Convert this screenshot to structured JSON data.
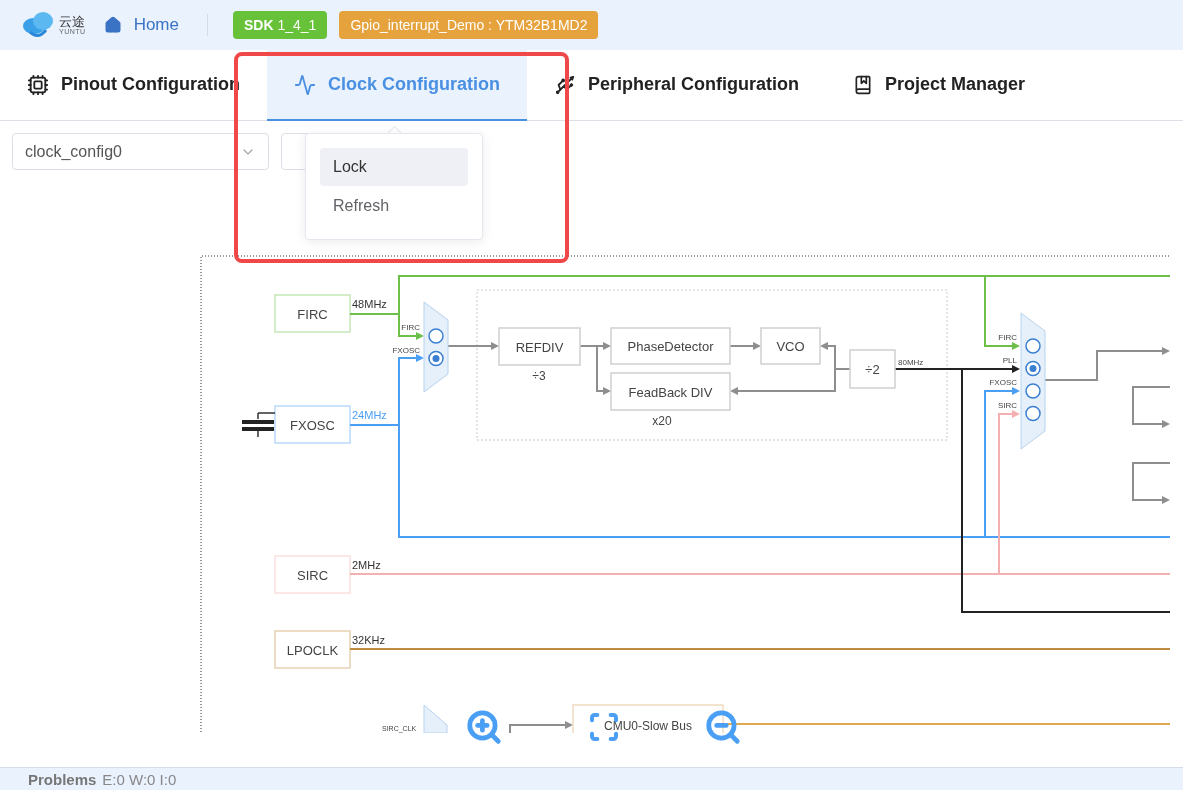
{
  "header": {
    "logo_text": "云途",
    "logo_subtext": "YUNTU",
    "home": "Home",
    "sdk_badge": "**SDK** 1_4_1",
    "project_badge": "Gpio_interrupt_Demo : YTM32B1MD2"
  },
  "tabs": [
    {
      "label": "Pinout Configuration",
      "kind": "chip",
      "selected": false
    },
    {
      "label": "Clock Configuration",
      "kind": "wave",
      "selected": true
    },
    {
      "label": "Peripheral Configuration",
      "kind": "peripheral",
      "selected": false
    },
    {
      "label": "Project Manager",
      "kind": "book",
      "selected": false
    }
  ],
  "toolbar": {
    "config_select": {
      "value": "clock_config0"
    }
  },
  "popover": {
    "items": [
      {
        "label": "Lock",
        "selected": true
      },
      {
        "label": "Refresh",
        "selected": false
      }
    ]
  },
  "diagram": {
    "sources": [
      {
        "name": "FIRC",
        "freq": "48MHz",
        "color": "#6cc04a"
      },
      {
        "name": "FXOSC",
        "freq": "24MHz",
        "color": "#4a9ff5"
      },
      {
        "name": "SIRC",
        "freq": "2MHz",
        "color": "#f4b0b0"
      },
      {
        "name": "LPOCLK",
        "freq": "32KHz",
        "color": "#c08a3e"
      }
    ],
    "pll": {
      "input_mux": [
        {
          "label": "FIRC",
          "selected": false
        },
        {
          "label": "FXOSC",
          "selected": true
        }
      ],
      "refdiv": {
        "label": "REFDIV",
        "factor": "÷3"
      },
      "phase_detector": "PhaseDetector",
      "feedback": {
        "label": "FeadBack DIV",
        "factor": "x20"
      },
      "vco": "VCO",
      "post_div": "÷2",
      "output_freq": "80MHz"
    },
    "system_mux": [
      {
        "label": "FIRC",
        "selected": false
      },
      {
        "label": "PLL",
        "selected": true
      },
      {
        "label": "FXOSC",
        "selected": false
      },
      {
        "label": "SIRC",
        "selected": false
      }
    ],
    "bottom": {
      "mux_label": "SIRC_CLK",
      "bus": "CMU0-Slow Bus"
    }
  },
  "problems": {
    "title": "Problems",
    "counts": "E:0 W:0 I:0"
  }
}
